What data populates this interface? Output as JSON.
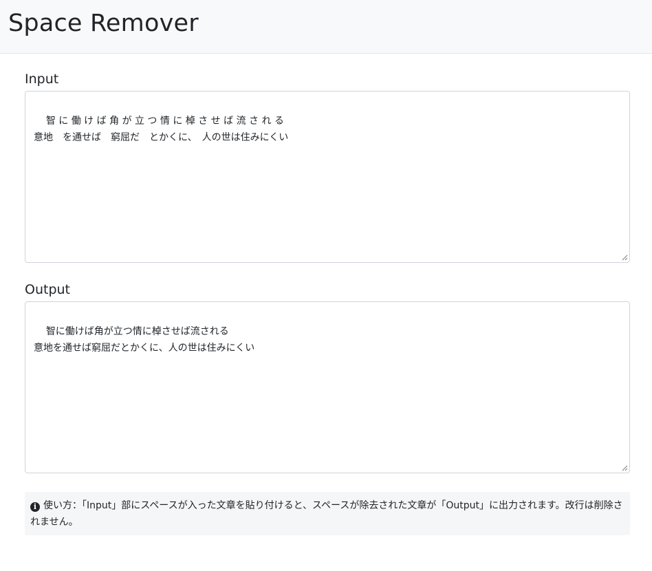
{
  "header": {
    "title": "Space Remover"
  },
  "input": {
    "label": "Input",
    "value": "智 に 働 け ば 角 が 立 つ 情 に 棹 さ せ ば 流 さ れ る\n意地　を通せば　窮屈だ　とかくに、　人の世は住みにくい"
  },
  "output": {
    "label": "Output",
    "value": "智に働けば角が立つ情に棹させば流される\n意地を通せば窮屈だとかくに、人の世は住みにくい"
  },
  "info": {
    "icon": "info-circle-icon",
    "text": "使い方：「Input」部にスペースが入った文章を貼り付けると、スペースが除去された文章が「Output」に出力されます。改行は削除されません。"
  }
}
